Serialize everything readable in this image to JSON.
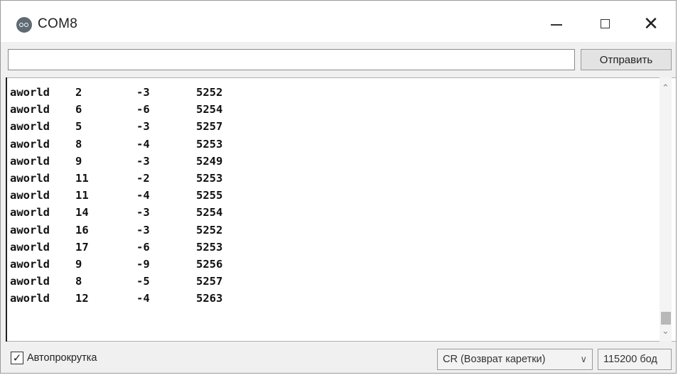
{
  "window": {
    "title": "COM8",
    "app_icon": "arduino-icon",
    "controls": {
      "minimize": "minimize-icon",
      "maximize": "maximize-icon",
      "close": "close-icon"
    }
  },
  "send": {
    "input_value": "",
    "button_label": "Отправить"
  },
  "output": {
    "lines": [
      [
        "aworld",
        "2",
        "-3",
        "5252"
      ],
      [
        "aworld",
        "6",
        "-6",
        "5254"
      ],
      [
        "aworld",
        "5",
        "-3",
        "5257"
      ],
      [
        "aworld",
        "8",
        "-4",
        "5253"
      ],
      [
        "aworld",
        "9",
        "-3",
        "5249"
      ],
      [
        "aworld",
        "11",
        "-2",
        "5253"
      ],
      [
        "aworld",
        "11",
        "-4",
        "5255"
      ],
      [
        "aworld",
        "14",
        "-3",
        "5254"
      ],
      [
        "aworld",
        "16",
        "-3",
        "5252"
      ],
      [
        "aworld",
        "17",
        "-6",
        "5253"
      ],
      [
        "aworld",
        "9",
        "-9",
        "5256"
      ],
      [
        "aworld",
        "8",
        "-5",
        "5257"
      ],
      [
        "aworld",
        "12",
        "-4",
        "5263"
      ]
    ]
  },
  "status": {
    "autoscroll_label": "Автопрокрутка",
    "autoscroll_checked": true,
    "line_ending": "CR (Возврат каретки)",
    "baud_rate": "115200 бод"
  }
}
